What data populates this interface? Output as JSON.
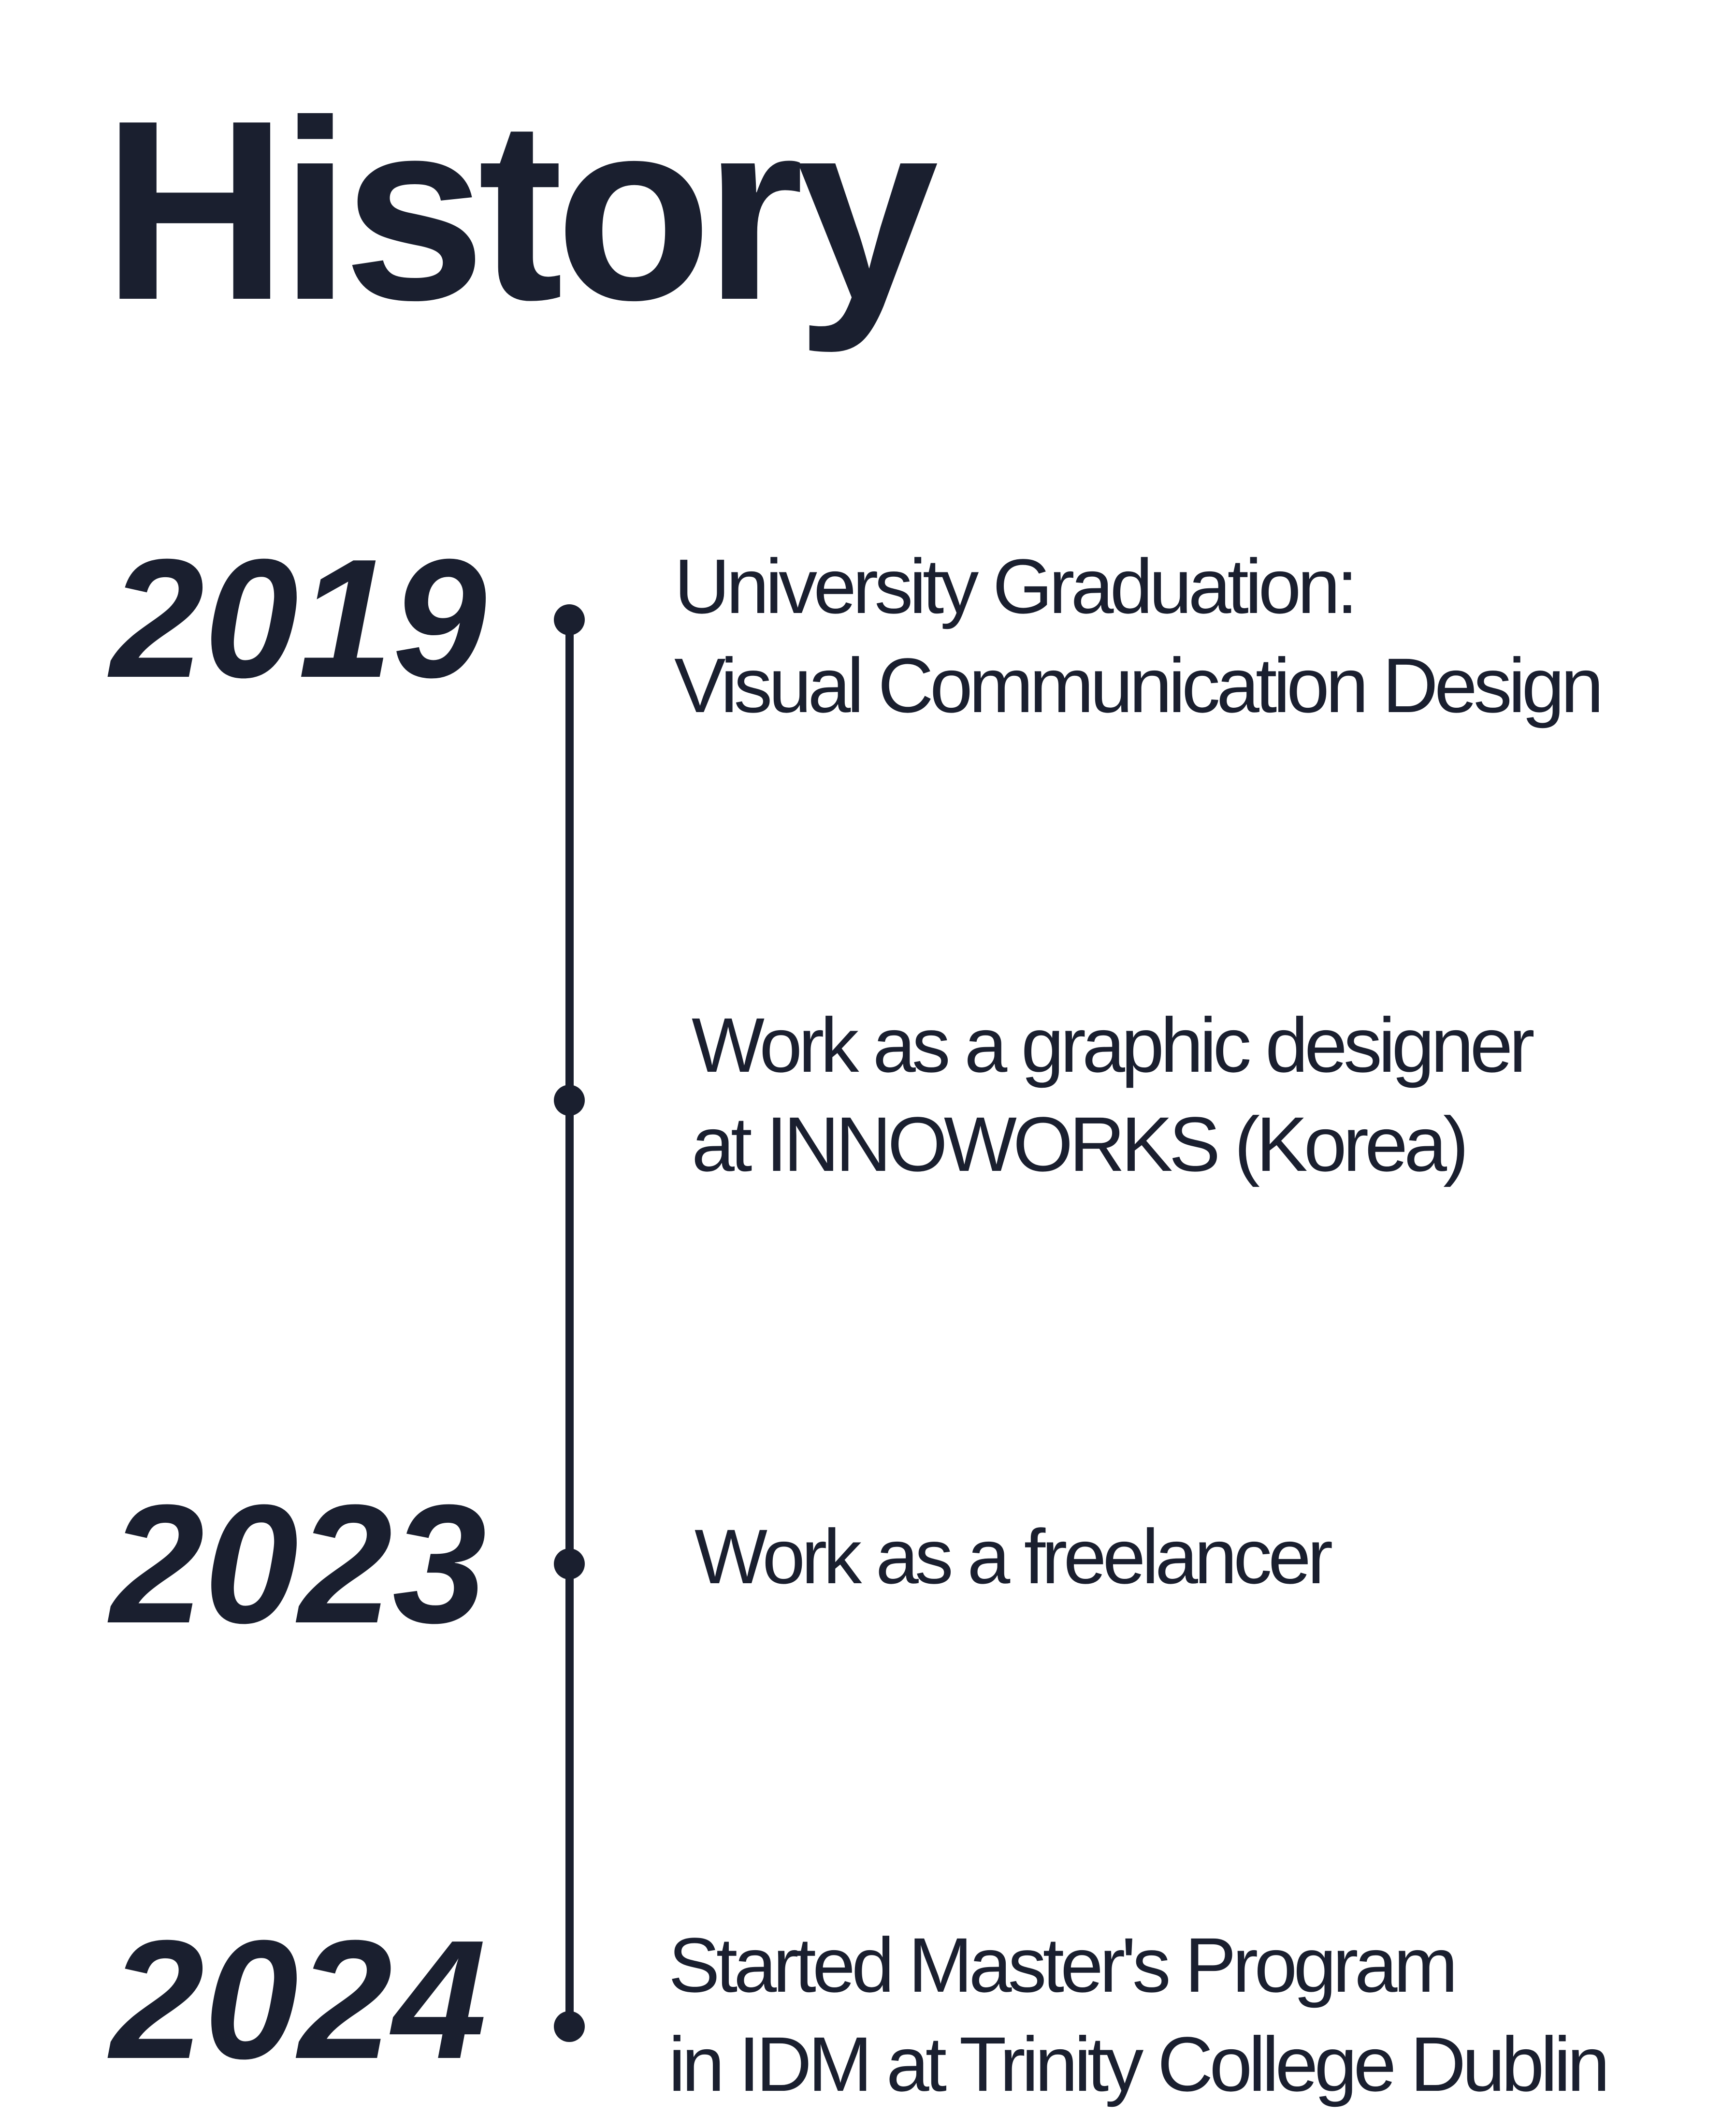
{
  "title": "History",
  "accent_color": "#1a1f2f",
  "timeline": [
    {
      "year": "2019",
      "lines": [
        "University Graduation:",
        "Visual Communication Design"
      ]
    },
    {
      "year": "",
      "lines": [
        "Work as a graphic designer",
        "at INNOWORKS (Korea)"
      ]
    },
    {
      "year": "2023",
      "lines": [
        "Work as a freelancer"
      ]
    },
    {
      "year": "2024",
      "lines": [
        "Started Master's Program",
        "in IDM at Trinity College Dublin"
      ]
    }
  ]
}
